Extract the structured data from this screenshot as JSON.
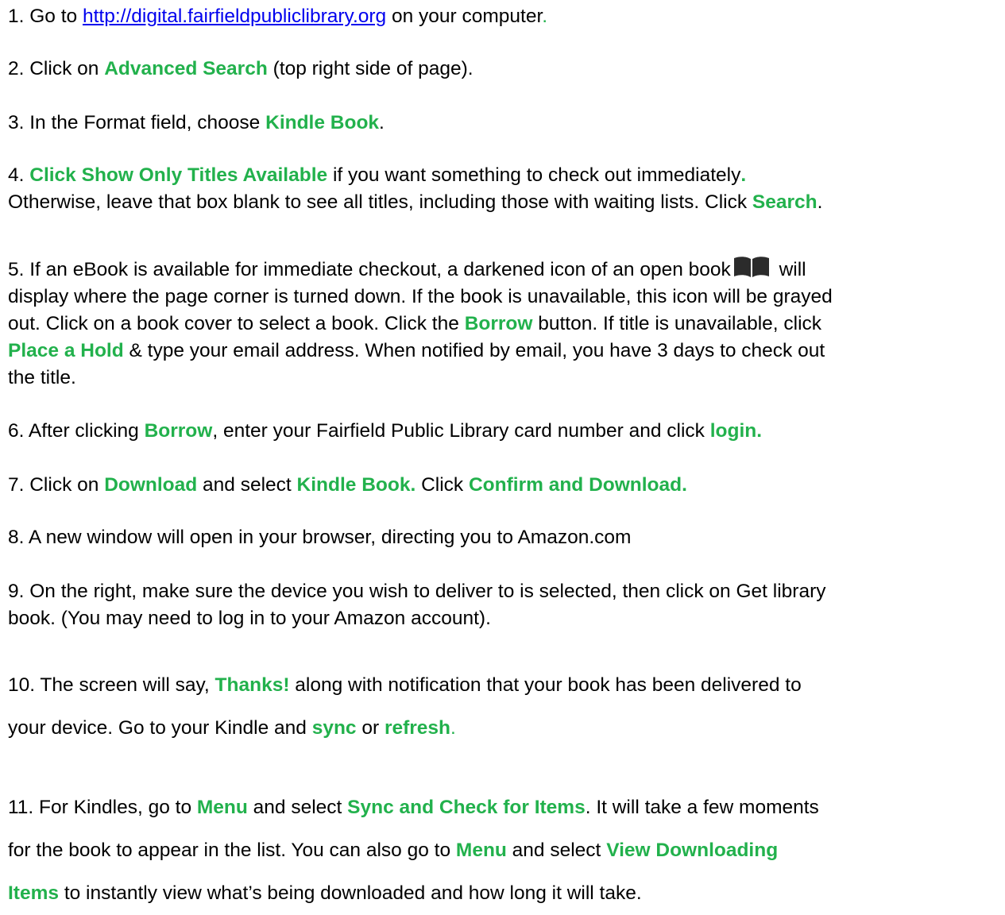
{
  "accent_color": "#22b14c",
  "link_color": "#0000ee",
  "steps": [
    {
      "lines": [
        [
          {
            "t": "1. Go to "
          },
          {
            "t": "http://digital.fairfieldpubliclibrary.org",
            "s": "link"
          },
          {
            "t": " on your computer"
          },
          {
            "t": ".",
            "s": "accent-plain"
          }
        ]
      ]
    },
    {
      "lines": [
        [
          {
            "t": "2. Click on "
          },
          {
            "t": "Advanced Search",
            "s": "accent"
          },
          {
            "t": " (top right side of page)."
          }
        ]
      ]
    },
    {
      "lines": [
        [
          {
            "t": "3. In the Format field, choose "
          },
          {
            "t": "Kindle Book",
            "s": "accent"
          },
          {
            "t": "."
          }
        ]
      ]
    },
    {
      "lines": [
        [
          {
            "t": "4. "
          },
          {
            "t": "Click Show Only Titles Available",
            "s": "accent"
          },
          {
            "t": " if you want something to check out immediately"
          },
          {
            "t": ".",
            "s": "accent"
          }
        ],
        [
          {
            "t": "Otherwise, leave that box blank to see all titles, including those with waiting lists. Click "
          },
          {
            "t": "Search",
            "s": "accent"
          },
          {
            "t": "."
          }
        ]
      ]
    },
    {
      "lines": [
        [
          {
            "t": "5. If an eBook is available for immediate checkout, a darkened icon of an open book"
          },
          {
            "icon": "open-book-icon"
          },
          {
            "t": " will"
          }
        ],
        [
          {
            "t": "display where the page corner is turned down. If the book is unavailable, this icon will be grayed"
          }
        ],
        [
          {
            "t": "out. Click on a book cover to select a book. Click the "
          },
          {
            "t": "Borrow",
            "s": "accent"
          },
          {
            "t": " button. If title is unavailable, click"
          }
        ],
        [
          {
            "t": "Place a Hold",
            "s": "accent"
          },
          {
            "t": " & type your email address. When notified by email, you have 3 days to check out"
          }
        ],
        [
          {
            "t": "the title."
          }
        ]
      ]
    },
    {
      "lines": [
        [
          {
            "t": "6. After clicking "
          },
          {
            "t": "Borrow",
            "s": "accent"
          },
          {
            "t": ", enter your Fairfield Public Library card number and click "
          },
          {
            "t": "login.",
            "s": "accent"
          }
        ]
      ]
    },
    {
      "lines": [
        [
          {
            "t": "7. Click on "
          },
          {
            "t": "Download",
            "s": "accent"
          },
          {
            "t": " and select "
          },
          {
            "t": "Kindle Book.",
            "s": "accent"
          },
          {
            "t": " Click "
          },
          {
            "t": "Confirm and Download.",
            "s": "accent"
          }
        ]
      ]
    },
    {
      "lines": [
        [
          {
            "t": "8. A new window will open in your browser, directing you to Amazon.com"
          }
        ]
      ]
    },
    {
      "lines": [
        [
          {
            "t": "9. On the right, make sure the device you wish to deliver to is selected, then click on Get library"
          }
        ],
        [
          {
            "t": "book. (You may need to log in to your Amazon account)."
          }
        ]
      ]
    },
    {
      "lines": [
        [
          {
            "t": "10. The screen will say, "
          },
          {
            "t": "Thanks!",
            "s": "accent"
          },
          {
            "t": " along with notification that your book has been delivered to"
          }
        ],
        [
          {
            "t": "your device. Go to your Kindle and "
          },
          {
            "t": "sync",
            "s": "accent"
          },
          {
            "t": " or "
          },
          {
            "t": "refresh",
            "s": "accent"
          },
          {
            "t": ".",
            "s": "accent-plain"
          }
        ]
      ]
    },
    {
      "lines": [
        [
          {
            "t": "11. For Kindles, go to "
          },
          {
            "t": "Menu",
            "s": "accent"
          },
          {
            "t": " and select "
          },
          {
            "t": "Sync and Check for Items",
            "s": "accent"
          },
          {
            "t": ". It will take a few moments"
          }
        ],
        [
          {
            "t": "for the book to appear in the list. You can also go to "
          },
          {
            "t": "Menu",
            "s": "accent"
          },
          {
            "t": " and select "
          },
          {
            "t": "View Downloading",
            "s": "accent"
          }
        ],
        [
          {
            "t": "Items",
            "s": "accent"
          },
          {
            "t": " to instantly view what’s being downloaded and how long it will take."
          }
        ]
      ]
    }
  ]
}
